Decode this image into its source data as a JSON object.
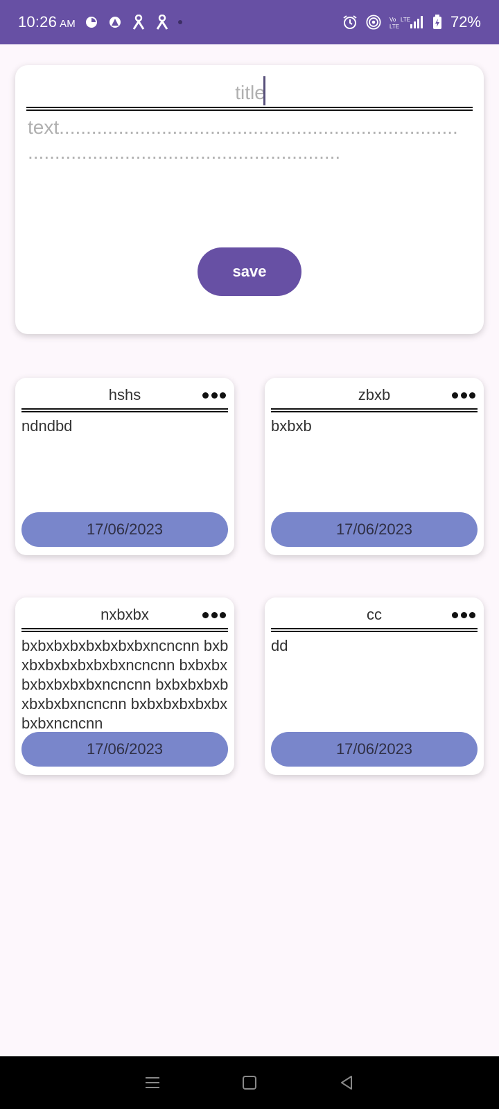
{
  "status_bar": {
    "time": "10:26",
    "ampm": "AM",
    "battery": "72%",
    "icons_left": [
      "app-icon-1",
      "app-icon-2",
      "app-icon-3",
      "app-icon-4"
    ],
    "icons_right": [
      "alarm-icon",
      "hotspot-icon",
      "signal-icon",
      "battery-icon"
    ]
  },
  "editor": {
    "title_placeholder": "title",
    "text_placeholder": "text..........................................................................\n..........................................................",
    "save_label": "save"
  },
  "notes": [
    {
      "title": "hshs",
      "body": "ndndbd",
      "date": "17/06/2023"
    },
    {
      "title": "zbxb",
      "body": "bxbxb",
      "date": "17/06/2023"
    },
    {
      "title": "nxbxbx",
      "body": "bxbxbxbxbxbxbxbxncncnn bxbxbxbxbxbxbxbxncncnn bxbxbxbxbxbxbxbxncncnn bxbxbxbxbxbxbxbxncncnn bxbxbxbxbxbxbxbxncncnn",
      "date": "17/06/2023"
    },
    {
      "title": "cc",
      "body": "dd",
      "date": "17/06/2023"
    }
  ],
  "colors": {
    "primary": "#6750a4",
    "date_pill": "#7986cb",
    "background": "#fdf7fc"
  }
}
